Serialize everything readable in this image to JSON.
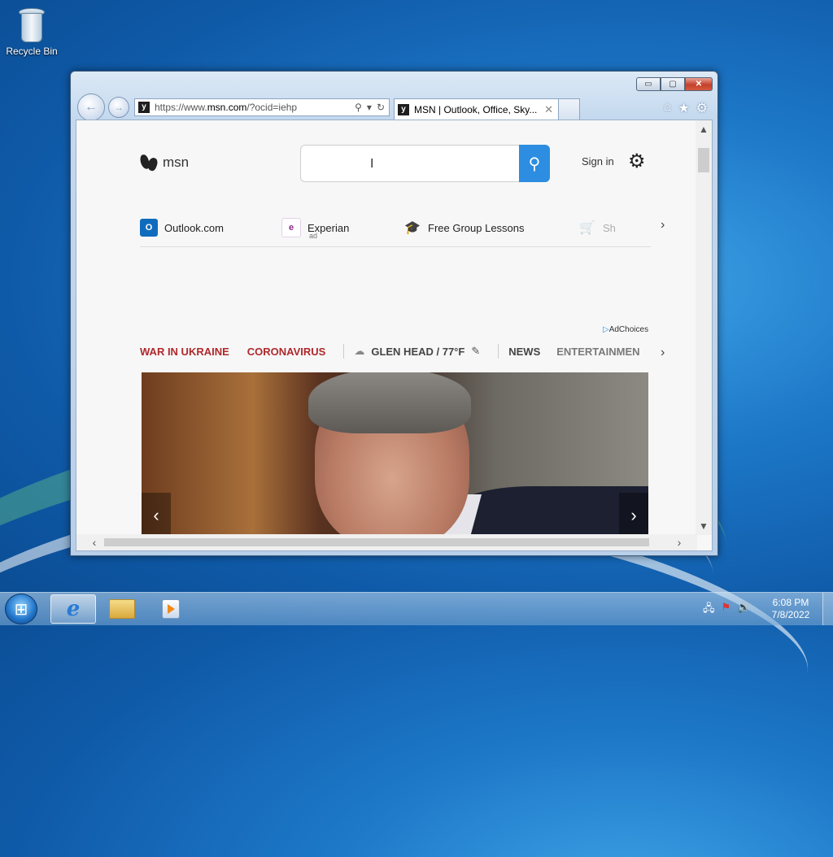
{
  "desktop": {
    "icons": [
      {
        "label": "Recycle Bin",
        "icon": "recycle-bin-icon"
      }
    ]
  },
  "browser": {
    "address_bar": {
      "url_prefix": "https://www.",
      "url_domain": "msn.com",
      "url_suffix": "/?ocid=iehp"
    },
    "tab": {
      "title": "MSN | Outlook, Office, Sky...",
      "close": "✕"
    },
    "caption": {
      "minimize": "▭",
      "maximize": "▢",
      "close": "✕"
    }
  },
  "page": {
    "logo_text": "msn",
    "sign_in": "Sign in",
    "quick_links": [
      {
        "label": "Outlook.com",
        "sub": "",
        "icon": "outlook-icon",
        "icon_text": "O",
        "color": "#0f6cbd"
      },
      {
        "label": "Experian",
        "sub": "ad",
        "icon": "experian-icon",
        "icon_text": "e",
        "color": "#8a2a8a"
      },
      {
        "label": "Free Group Lessons",
        "sub": "",
        "icon": "graduation-cap-icon",
        "icon_text": "🎓",
        "color": "#6b2fa0"
      },
      {
        "label": "Sh",
        "sub": "",
        "icon": "shopping-cart-icon",
        "icon_text": "🛒",
        "color": "#2d8de0"
      }
    ],
    "adchoices": "AdChoices",
    "nav": {
      "war": "WAR IN UKRAINE",
      "corona": "CORONAVIRUS",
      "weather": "GLEN HEAD / 77°F",
      "news": "NEWS",
      "entertainment": "ENTERTAINMEN"
    }
  },
  "taskbar": {
    "time": "6:08 PM",
    "date": "7/8/2022",
    "apps": [
      "internet-explorer",
      "windows-explorer",
      "windows-media-player"
    ]
  }
}
